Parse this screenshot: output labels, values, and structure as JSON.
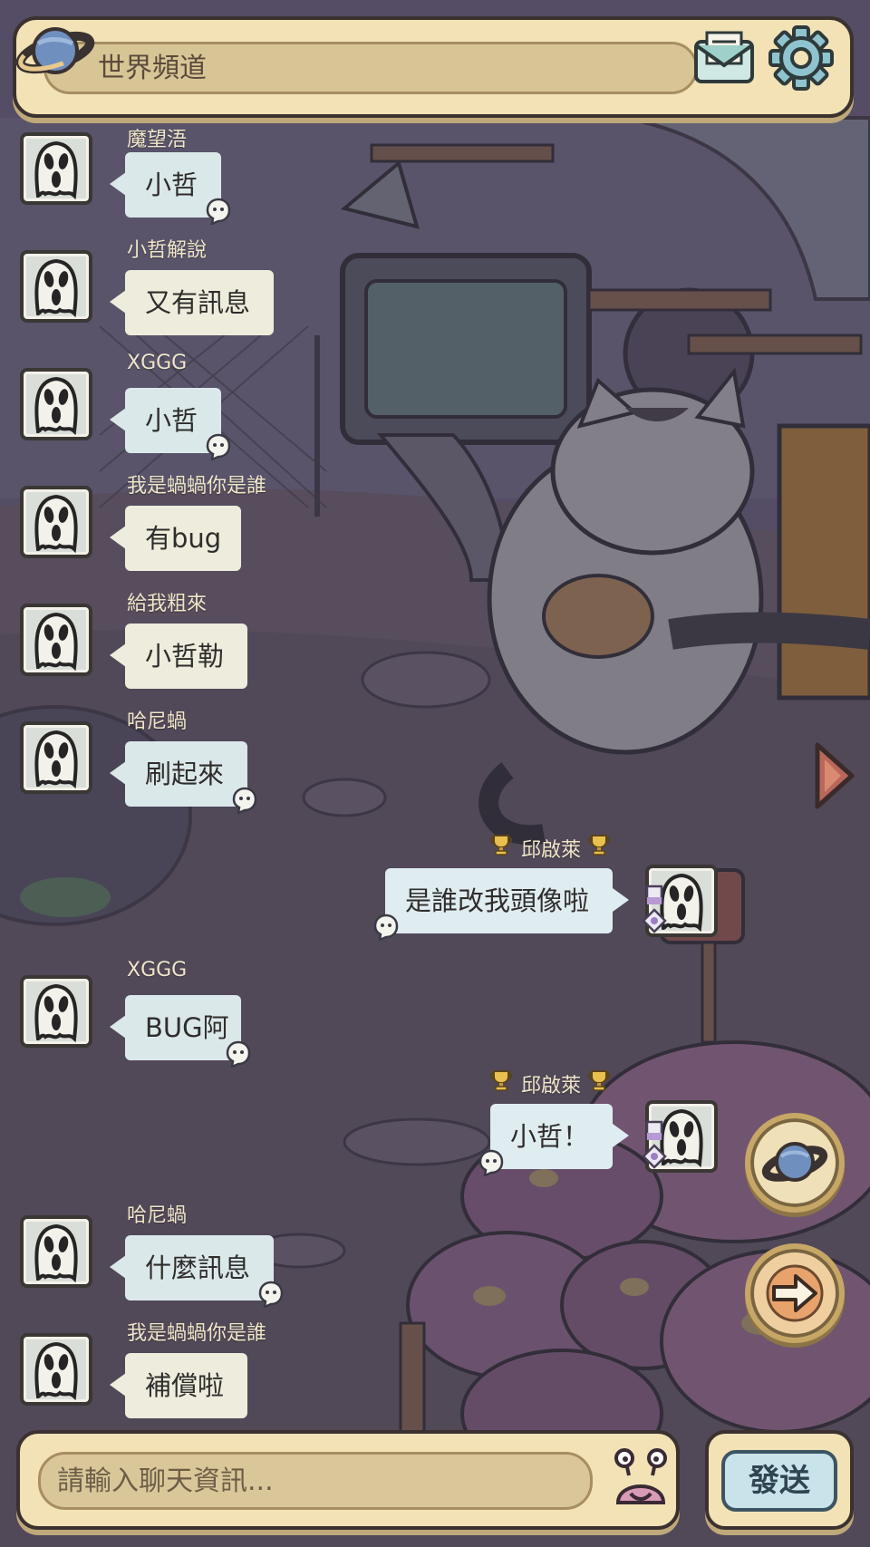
{
  "header": {
    "channel_title": "世界頻道",
    "icons": [
      "planet-icon",
      "mail-icon",
      "gear-icon"
    ]
  },
  "messages": [
    {
      "side": "left",
      "sender": "魔望浯",
      "text": "小哲",
      "has_badge": true,
      "bubble_style": "blue"
    },
    {
      "side": "left",
      "sender": "小哲解說",
      "text": "又有訊息",
      "has_badge": false,
      "bubble_style": "plain"
    },
    {
      "side": "left",
      "sender": "XGGG",
      "text": "小哲",
      "has_badge": true,
      "bubble_style": "blue"
    },
    {
      "side": "left",
      "sender": "我是蝸蝸你是誰",
      "text": "有bug",
      "has_badge": false,
      "bubble_style": "plain"
    },
    {
      "side": "left",
      "sender": "給我粗來",
      "text": "小哲勒",
      "has_badge": false,
      "bubble_style": "plain"
    },
    {
      "side": "left",
      "sender": "哈尼蝸",
      "text": "刷起來",
      "has_badge": true,
      "bubble_style": "blue"
    },
    {
      "side": "right",
      "sender": "邱啟萊",
      "text": "是誰改我頭像啦",
      "has_badge": true,
      "bubble_style": "blue"
    },
    {
      "side": "left",
      "sender": "XGGG",
      "text": "BUG阿",
      "has_badge": true,
      "bubble_style": "blue"
    },
    {
      "side": "right",
      "sender": "邱啟萊",
      "text": "小哲！",
      "has_badge": true,
      "bubble_style": "blue"
    },
    {
      "side": "left",
      "sender": "哈尼蝸",
      "text": "什麼訊息",
      "has_badge": true,
      "bubble_style": "blue"
    },
    {
      "side": "left",
      "sender": "我是蝸蝸你是誰",
      "text": "補償啦",
      "has_badge": false,
      "bubble_style": "plain"
    }
  ],
  "input": {
    "placeholder": "請輸入聊天資訊..."
  },
  "send_label": "發送",
  "side_buttons": [
    "planet-button",
    "arrow-button"
  ],
  "colors": {
    "panel": "#f2e2b6",
    "panel_border": "#3b3230",
    "field": "#d8c596",
    "bubble": "#eeecdd",
    "bubble_blue": "#dbe8ea",
    "send_button": "#c8e3ea",
    "username": "#efe6c9"
  }
}
